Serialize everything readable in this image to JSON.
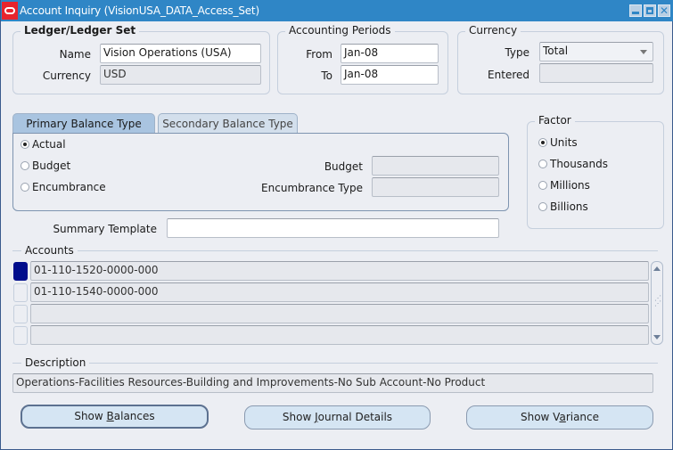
{
  "window": {
    "title": "Account Inquiry (VisionUSA_DATA_Access_Set)",
    "controls": [
      "minimize",
      "maximize",
      "close"
    ]
  },
  "ledger": {
    "title": "Ledger/Ledger Set",
    "name_label": "Name",
    "name_value": "Vision Operations (USA)",
    "currency_label": "Currency",
    "currency_value": "USD"
  },
  "periods": {
    "title": "Accounting Periods",
    "from_label": "From",
    "from_value": "Jan-08",
    "to_label": "To",
    "to_value": "Jan-08"
  },
  "currency": {
    "title": "Currency",
    "type_label": "Type",
    "type_value": "Total",
    "entered_label": "Entered",
    "entered_value": ""
  },
  "tabs": [
    {
      "label": "Primary Balance Type",
      "active": true
    },
    {
      "label": "Secondary Balance Type",
      "active": false
    }
  ],
  "balance_type": {
    "options": [
      {
        "label": "Actual",
        "selected": true
      },
      {
        "label": "Budget",
        "selected": false
      },
      {
        "label": "Encumbrance",
        "selected": false
      }
    ],
    "budget_label": "Budget",
    "budget_value": "",
    "encumbrance_type_label": "Encumbrance Type",
    "encumbrance_type_value": ""
  },
  "factor": {
    "title": "Factor",
    "options": [
      {
        "label": "Units",
        "selected": true
      },
      {
        "label": "Thousands",
        "selected": false
      },
      {
        "label": "Millions",
        "selected": false
      },
      {
        "label": "Billions",
        "selected": false
      }
    ]
  },
  "summary_template": {
    "label": "Summary Template",
    "value": ""
  },
  "accounts": {
    "title": "Accounts",
    "rows": [
      "01-110-1520-0000-000",
      "01-110-1540-0000-000",
      "",
      ""
    ]
  },
  "description": {
    "title": "Description",
    "value": "Operations-Facilities Resources-Building and Improvements-No Sub Account-No Product"
  },
  "buttons": {
    "show_balances": {
      "pre": "Show ",
      "mnemonic": "B",
      "post": "alances"
    },
    "show_journal": {
      "pre": "Show ",
      "mnemonic": "J",
      "post": "ournal Details"
    },
    "show_variance": {
      "pre": "Show V",
      "mnemonic": "a",
      "post": "riance"
    }
  }
}
